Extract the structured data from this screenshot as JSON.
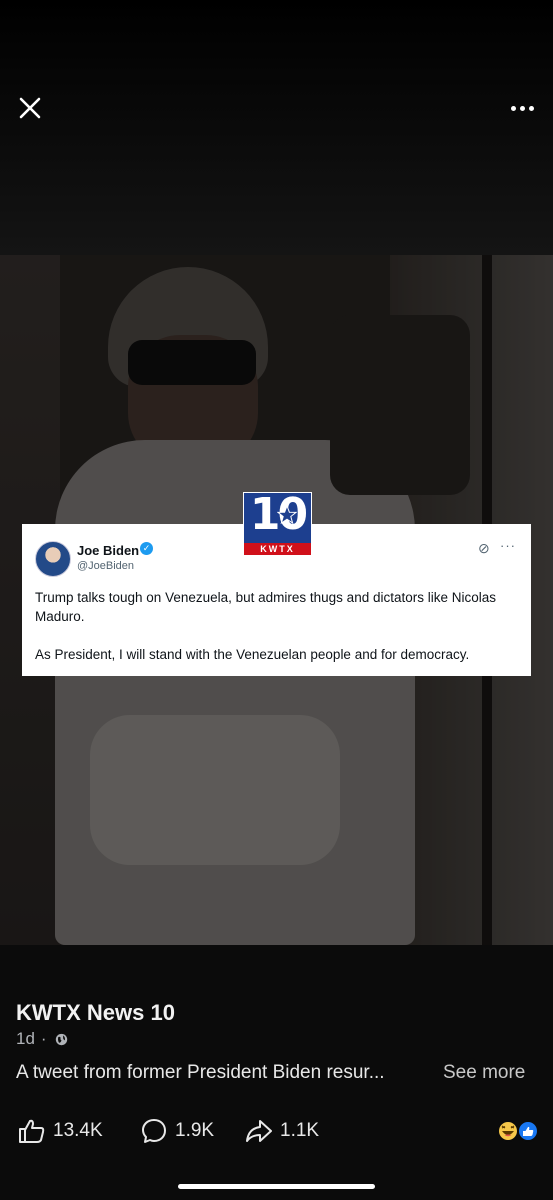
{
  "viewer": {
    "close_icon": "close-icon",
    "more_icon": "more-horizontal-icon"
  },
  "overlay": {
    "logo": {
      "number": "10",
      "label": "KWTX"
    },
    "tweet": {
      "name": "Joe Biden",
      "handle": "@JoeBiden",
      "text": "Trump talks tough on Venezuela, but admires thugs and dictators like Nicolas Maduro.\n\nAs President, I will stand with the Venezuelan people and for democracy."
    }
  },
  "post": {
    "author": "KWTX News 10",
    "time": "1d",
    "separator": "·",
    "visibility_icon": "globe-icon",
    "caption": "A tweet from former President Biden resur...",
    "see_more": "See more"
  },
  "actions": {
    "likes": "13.4K",
    "comments": "1.9K",
    "shares": "1.1K",
    "reaction_icons": [
      "laugh-reaction-icon",
      "like-reaction-icon"
    ]
  },
  "colors": {
    "background": "#0b0b0b",
    "logo_blue": "#1d3f8f",
    "logo_red": "#d0101a",
    "verified_blue": "#1d9bf0"
  }
}
